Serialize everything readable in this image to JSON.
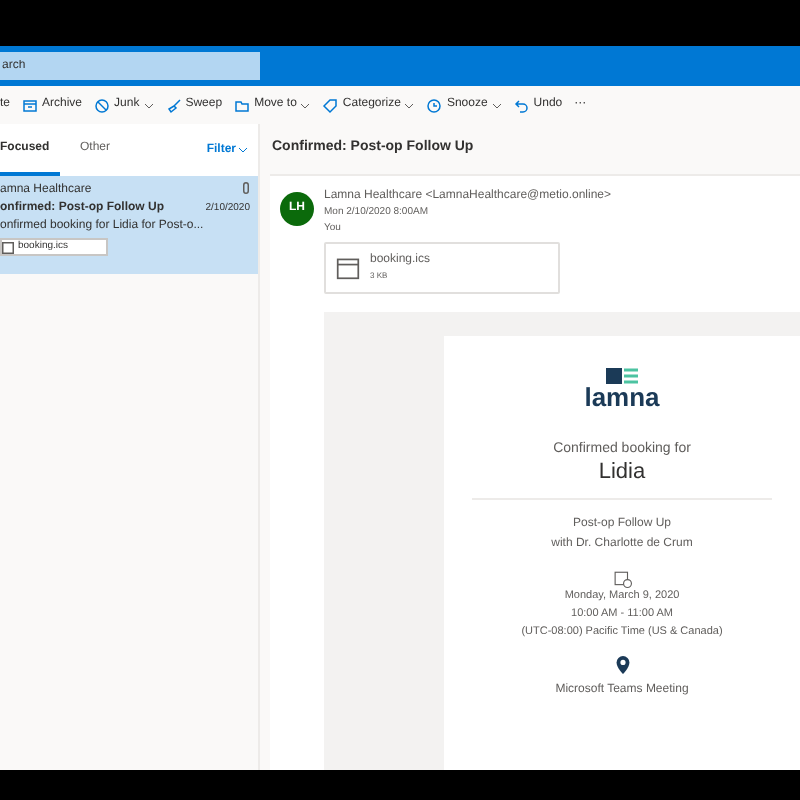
{
  "search": {
    "placeholder": "arch"
  },
  "toolbar": [
    {
      "label": "te",
      "has_menu": false
    },
    {
      "label": "Archive",
      "has_menu": false
    },
    {
      "label": "Junk",
      "has_menu": true
    },
    {
      "label": "Sweep",
      "has_menu": false
    },
    {
      "label": "Move to",
      "has_menu": true
    },
    {
      "label": "Categorize",
      "has_menu": true
    },
    {
      "label": "Snooze",
      "has_menu": true
    },
    {
      "label": "Undo",
      "has_menu": false
    },
    {
      "label": "···",
      "has_menu": false
    }
  ],
  "tabs": [
    {
      "label": "Focused",
      "selected": true
    },
    {
      "label": "Other",
      "selected": false
    }
  ],
  "filter": "Filter",
  "messages": [
    {
      "sender": "amna Healthcare",
      "subject": "onfirmed: Post-op Follow Up",
      "date": "2/10/2020",
      "preview": "onfirmed booking for Lidia for Post-o...",
      "attachment": "booking.ics",
      "selected": true
    }
  ],
  "reading": {
    "subject": "Confirmed: Post-op Follow Up",
    "avatar": "LH",
    "from": "Lamna Healthcare <LamnaHealthcare@metio.online>",
    "sent": "Mon 2/10/2020 8:00AM",
    "to": "You",
    "attachment": {
      "name": "booking.ics",
      "size": "3 KB"
    },
    "email": {
      "logo": "lamna",
      "heading": "Confirmed booking for",
      "name": "Lidia",
      "service": "Post-op Follow Up",
      "provider": "with Dr. Charlotte de Crum",
      "when": [
        "Monday, March 9, 2020",
        "10:00 AM - 11:00 AM",
        "(UTC-08:00) Pacific Time (US & Canada)"
      ],
      "location": "Microsoft Teams Meeting"
    }
  }
}
